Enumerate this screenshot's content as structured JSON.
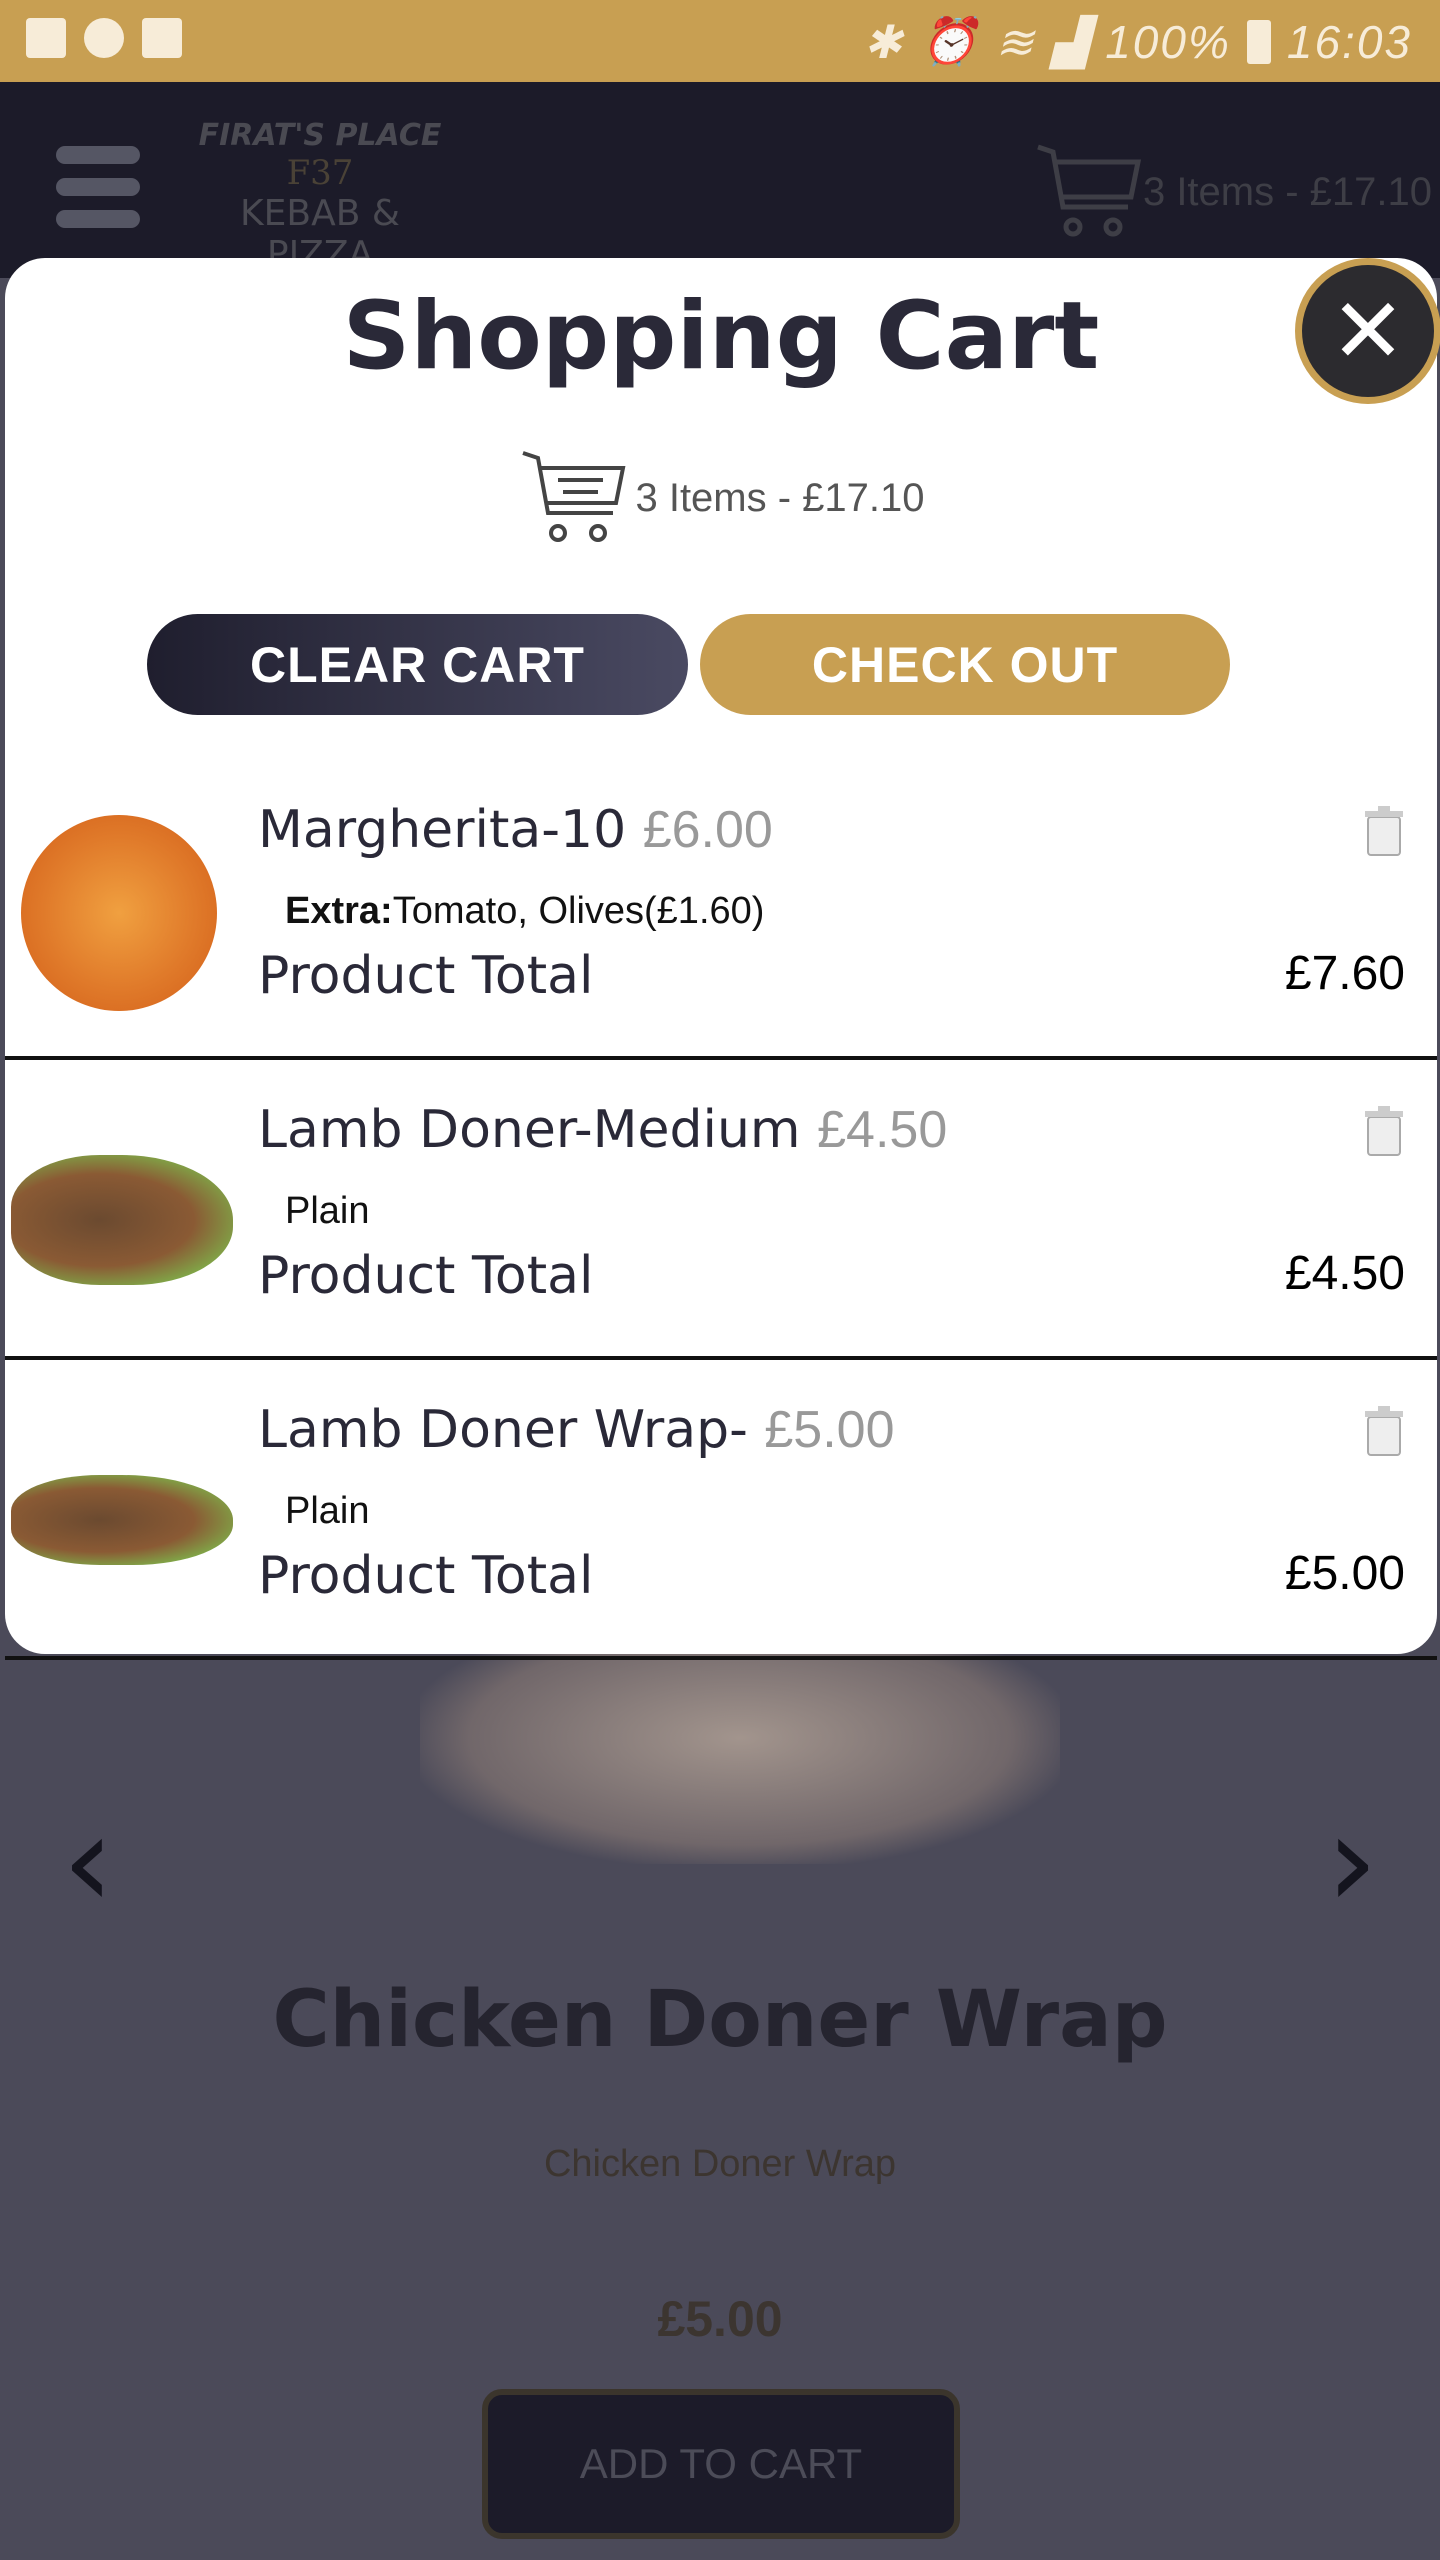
{
  "status_bar": {
    "battery": "100%",
    "time": "16:03",
    "icons": [
      "image-icon",
      "key-icon",
      "activity-icon",
      "bluetooth-icon",
      "alarm-icon",
      "wifi-icon",
      "signal-icon",
      "battery-icon"
    ]
  },
  "header": {
    "logo_line1": "FIRAT'S PLACE",
    "logo_line2": "F37",
    "logo_line3": "KEBAB & PIZZA",
    "cart_summary": "3 Items - £17.10"
  },
  "modal": {
    "title": "Shopping Cart",
    "cart_summary": "3 Items - £17.10",
    "clear_label": "CLEAR CART",
    "checkout_label": "CHECK OUT",
    "items": [
      {
        "name": "Margherita-10",
        "price": "£6.00",
        "extra_label": "Extra:",
        "extra": "Tomato, Olives(£1.60)",
        "total_label": "Product Total",
        "total": "£7.60"
      },
      {
        "name": "Lamb Doner-Medium",
        "price": "£4.50",
        "extra_label": "",
        "extra": "Plain",
        "total_label": "Product Total",
        "total": "£4.50"
      },
      {
        "name": "Lamb Doner Wrap-",
        "price": "£5.00",
        "extra_label": "",
        "extra": "Plain",
        "total_label": "Product Total",
        "total": "£5.00"
      }
    ]
  },
  "product": {
    "title": "Chicken Doner Wrap",
    "subtitle": "Chicken Doner Wrap",
    "price": "£5.00",
    "add_label": "ADD TO CART"
  },
  "colors": {
    "accent": "#c89f52",
    "dark": "#1c1b29"
  }
}
